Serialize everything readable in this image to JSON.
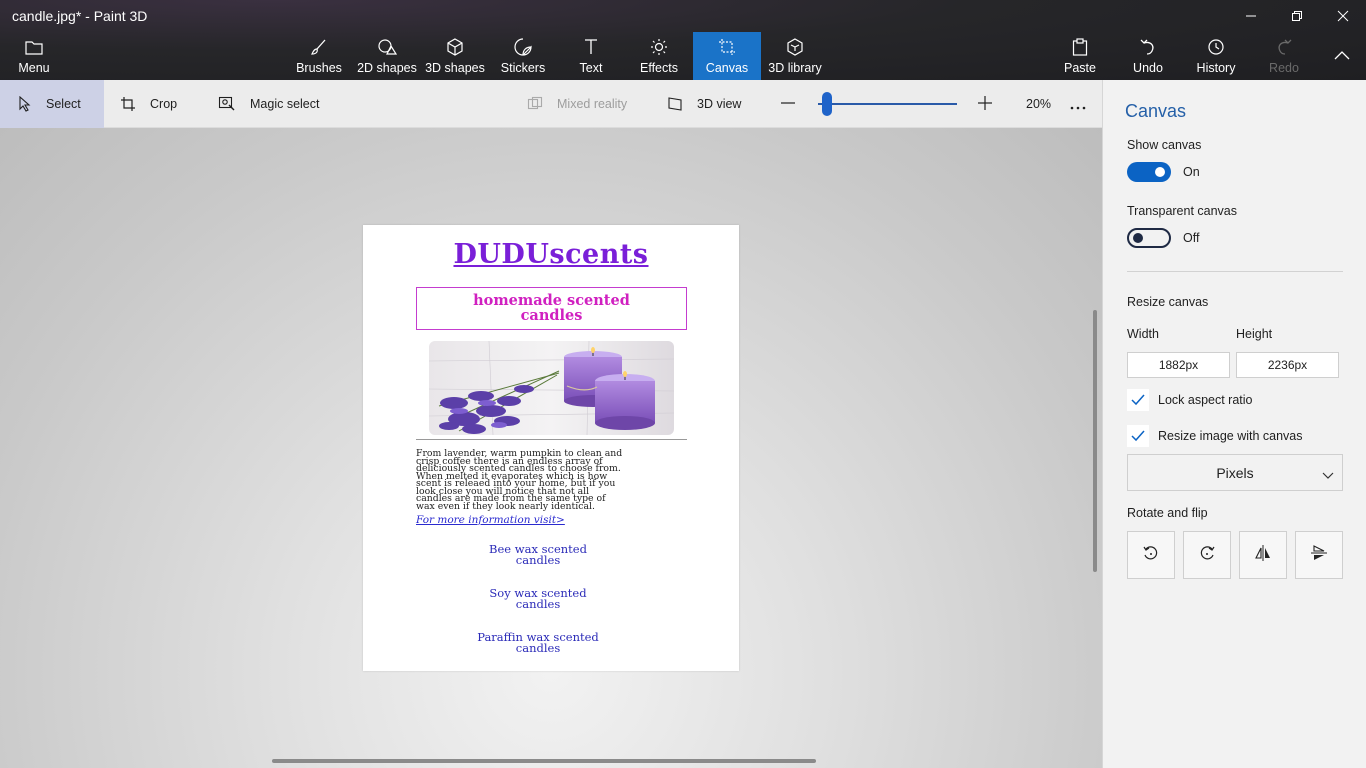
{
  "window": {
    "title": "candle.jpg* - Paint 3D"
  },
  "topbar": {
    "menu": {
      "label": "Menu",
      "icon": "folder-icon"
    },
    "tabs": [
      {
        "label": "Brushes",
        "icon": "brush-icon"
      },
      {
        "label": "2D shapes",
        "icon": "2d-shapes-icon"
      },
      {
        "label": "3D shapes",
        "icon": "3d-shapes-icon"
      },
      {
        "label": "Stickers",
        "icon": "stickers-icon"
      },
      {
        "label": "Text",
        "icon": "text-icon"
      },
      {
        "label": "Effects",
        "icon": "effects-icon"
      },
      {
        "label": "Canvas",
        "icon": "canvas-icon",
        "active": true
      },
      {
        "label": "3D library",
        "icon": "3d-library-icon"
      }
    ],
    "actions": [
      {
        "label": "Paste",
        "icon": "paste-icon"
      },
      {
        "label": "Undo",
        "icon": "undo-icon"
      },
      {
        "label": "History",
        "icon": "history-icon"
      },
      {
        "label": "Redo",
        "icon": "redo-icon",
        "disabled": true
      }
    ]
  },
  "toolbar": {
    "select": "Select",
    "crop": "Crop",
    "magic_select": "Magic select",
    "mixed_reality": "Mixed reality",
    "view_3d": "3D view",
    "zoom": "20%",
    "zoom_level": 0.05
  },
  "document": {
    "title": "DUDUscents",
    "subtitle_line1": "homemade scented",
    "subtitle_line2": "candles",
    "body": [
      "From lavender, warm pumpkin to clean and",
      "crisp coffee there is an endless array of",
      "deliciously scented candles to choose from.",
      "When melted it evaporates which is how",
      "scent is releaed into your home, but if you",
      "look close you will notice that not all",
      "candles are made from the same type of",
      "wax even if they look nearly identical."
    ],
    "link": "For more information visit>",
    "items": [
      {
        "line1": "Bee wax scented",
        "line2": "candles"
      },
      {
        "line1": "Soy wax scented",
        "line2": "candles"
      },
      {
        "line1": "Paraffin wax scented",
        "line2": "candles"
      }
    ]
  },
  "panel": {
    "title": "Canvas",
    "show_canvas_label": "Show canvas",
    "show_canvas_state": "On",
    "transparent_label": "Transparent canvas",
    "transparent_state": "Off",
    "resize_label": "Resize canvas",
    "width_label": "Width",
    "height_label": "Height",
    "width_value": "1882px",
    "height_value": "2236px",
    "lock_aspect": "Lock aspect ratio",
    "resize_image": "Resize image with canvas",
    "units": "Pixels",
    "rotate_label": "Rotate and flip"
  },
  "colors": {
    "accent": "#1a73c8",
    "panel_title": "#2560a8",
    "doc_title": "#7a1fd8",
    "doc_subtitle": "#d020c0"
  }
}
